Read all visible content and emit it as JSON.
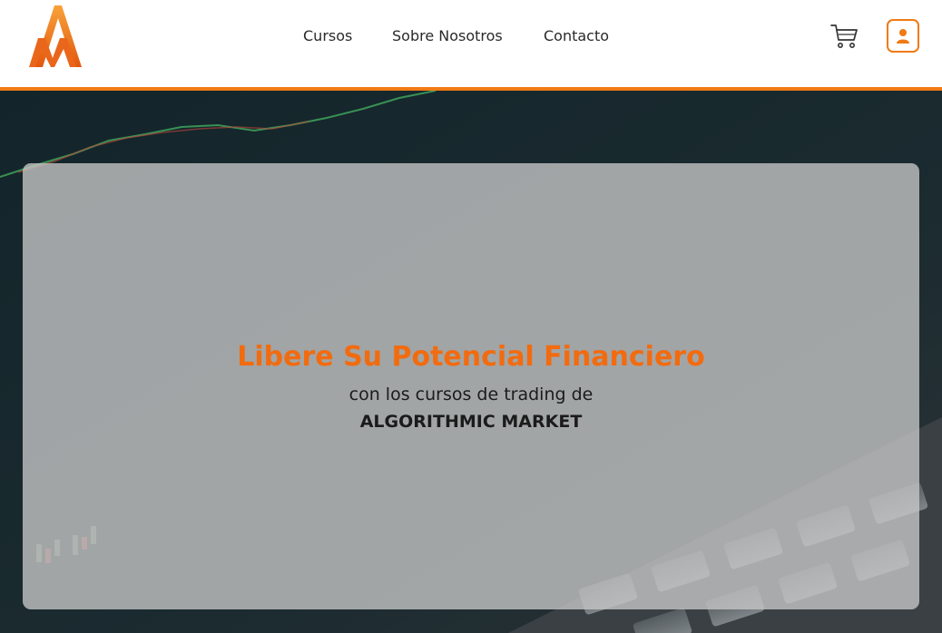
{
  "header": {
    "logo": {
      "icon": "am-logo-icon"
    },
    "nav": [
      {
        "label": "Cursos"
      },
      {
        "label": "Sobre Nosotros"
      },
      {
        "label": "Contacto"
      }
    ],
    "cart_icon": "shopping-cart-icon",
    "user_icon": "user-icon"
  },
  "hero": {
    "background": "laptop-trading-chart-photo",
    "title": "Libere Su Potencial Financiero",
    "subtitle": "con los cursos de trading de",
    "brand": "ALGORITHMIC MARKET"
  },
  "colors": {
    "accent": "#f07a14",
    "title": "#f26b0f",
    "text": "#1b1b1b",
    "card_overlay": "rgba(200,200,200,0.78)"
  }
}
